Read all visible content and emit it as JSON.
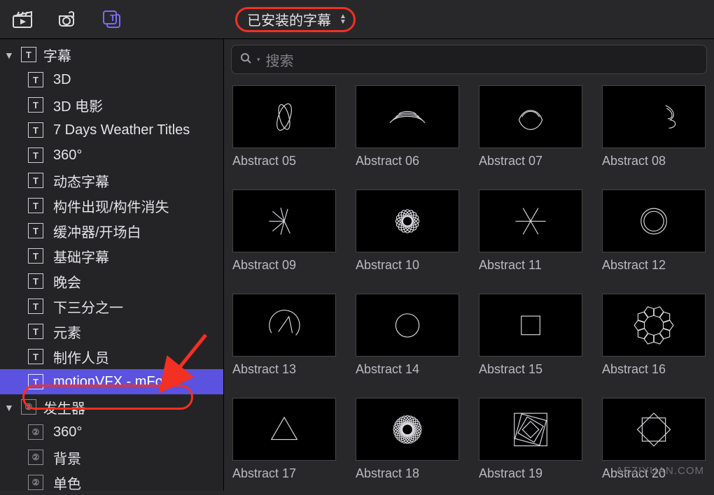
{
  "topbar": {
    "dropdown_label": "已安装的字幕"
  },
  "search": {
    "placeholder": "搜索"
  },
  "sidebar": {
    "group1": {
      "header": "字幕",
      "items": [
        "3D",
        "3D 电影",
        "7 Days Weather Titles",
        "360°",
        "动态字幕",
        "构件出现/构件消失",
        "缓冲器/开场白",
        "基础字幕",
        "晚会",
        "下三分之一",
        "元素",
        "制作人员",
        "motionVFX - mForm"
      ],
      "selected_index": 12
    },
    "group2": {
      "header": "发生器",
      "items": [
        "360°",
        "背景",
        "单色"
      ]
    }
  },
  "grid": {
    "tiles": [
      {
        "label": "Abstract 05"
      },
      {
        "label": "Abstract 06"
      },
      {
        "label": "Abstract 07"
      },
      {
        "label": "Abstract 08"
      },
      {
        "label": "Abstract 09"
      },
      {
        "label": "Abstract 10"
      },
      {
        "label": "Abstract 11"
      },
      {
        "label": "Abstract 12"
      },
      {
        "label": "Abstract 13"
      },
      {
        "label": "Abstract 14"
      },
      {
        "label": "Abstract 15"
      },
      {
        "label": "Abstract 16"
      },
      {
        "label": "Abstract 17"
      },
      {
        "label": "Abstract 18"
      },
      {
        "label": "Abstract 19"
      },
      {
        "label": "Abstract 20"
      }
    ]
  },
  "watermark": "AEZIYUAN.COM"
}
